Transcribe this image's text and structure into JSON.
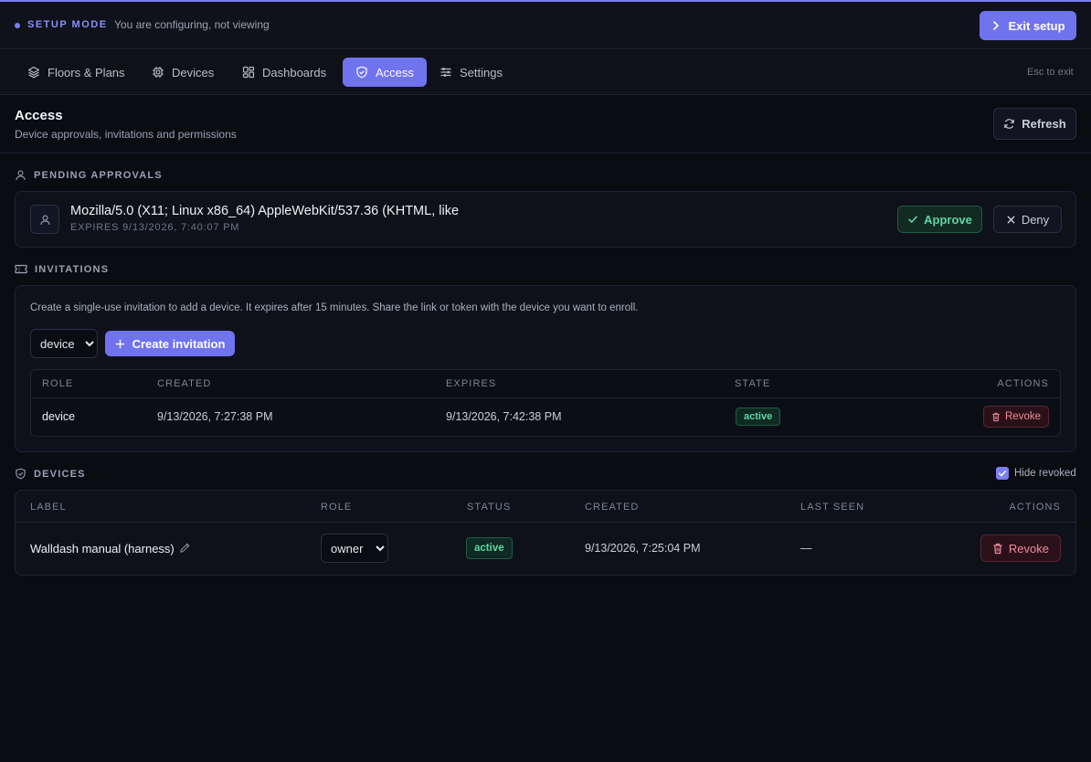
{
  "setup_bar": {
    "mode_label": "SETUP MODE",
    "subtitle": "You are configuring, not viewing",
    "exit_label": "Exit setup"
  },
  "nav": {
    "tabs": [
      {
        "label": "Floors & Plans",
        "icon": "layers-icon"
      },
      {
        "label": "Devices",
        "icon": "chip-icon"
      },
      {
        "label": "Dashboards",
        "icon": "dashboard-grid-icon"
      },
      {
        "label": "Access",
        "icon": "shield-icon",
        "active": true
      },
      {
        "label": "Settings",
        "icon": "sliders-icon"
      }
    ],
    "esc_hint": "Esc to exit"
  },
  "header": {
    "title": "Access",
    "subtitle": "Device approvals, invitations and permissions",
    "refresh_label": "Refresh"
  },
  "pending": {
    "section_title": "PENDING APPROVALS",
    "items": [
      {
        "user_agent": "Mozilla/5.0 (X11; Linux x86_64) AppleWebKit/537.36 (KHTML, like",
        "expires": "EXPIRES 9/13/2026, 7:40:07 PM",
        "approve_label": "Approve",
        "deny_label": "Deny"
      }
    ]
  },
  "invitations": {
    "section_title": "INVITATIONS",
    "description": "Create a single-use invitation to add a device. It expires after 15 minutes. Share the link or token with the device you want to enroll.",
    "role_value": "device",
    "create_label": "Create invitation",
    "columns": [
      "ROLE",
      "CREATED",
      "EXPIRES",
      "STATE",
      "ACTIONS"
    ],
    "rows": [
      {
        "role": "device",
        "created": "9/13/2026, 7:27:38 PM",
        "expires": "9/13/2026, 7:42:38 PM",
        "state": "active",
        "action": "Revoke"
      }
    ]
  },
  "devices": {
    "section_title": "DEVICES",
    "hide_revoked_label": "Hide revoked",
    "hide_revoked_checked": true,
    "columns": [
      "LABEL",
      "ROLE",
      "STATUS",
      "CREATED",
      "LAST SEEN",
      "ACTIONS"
    ],
    "rows": [
      {
        "label": "Walldash manual (harness)",
        "role": "owner",
        "status": "active",
        "created": "9/13/2026, 7:25:04 PM",
        "last_seen": "—",
        "action": "Revoke"
      }
    ]
  },
  "colors": {
    "accent": "#7073ee",
    "success": "#5fd6a4",
    "danger": "#f08a9c",
    "background": "#0a0c12"
  }
}
